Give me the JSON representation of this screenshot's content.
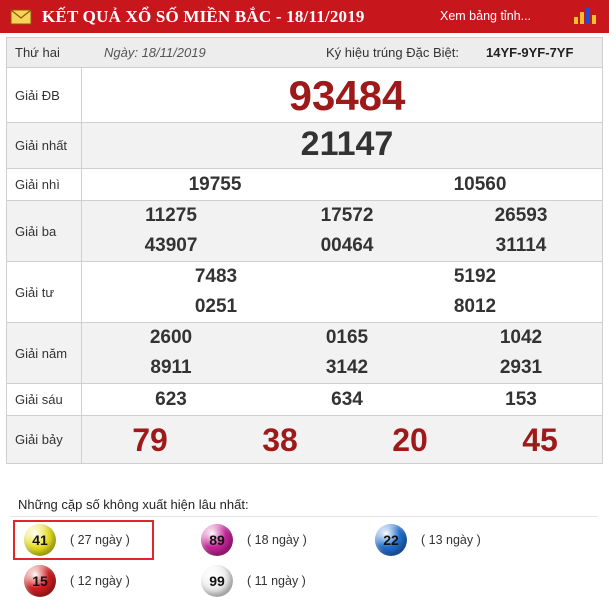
{
  "header": {
    "title": "KẾT QUẢ XỔ SỐ MIỀN BẮC - 18/11/2019",
    "link": "Xem bảng tỉnh...",
    "bg_color": "#c8161d",
    "mail_icon": "mail-icon",
    "chart_icon": "bar-chart-icon"
  },
  "info": {
    "day": "Thứ hai",
    "date": "Ngày: 18/11/2019",
    "special_code_label": "Ký hiệu trúng Đặc Biệt:",
    "special_code": "14YF-9YF-7YF"
  },
  "prizes": {
    "db": {
      "label": "Giải ĐB",
      "numbers": [
        "93484"
      ]
    },
    "nhat": {
      "label": "Giải nhất",
      "numbers": [
        "21147"
      ]
    },
    "nhi": {
      "label": "Giải nhì",
      "numbers": [
        "19755",
        "10560"
      ]
    },
    "ba": {
      "label": "Giải ba",
      "numbers": [
        "11275",
        "17572",
        "26593",
        "43907",
        "00464",
        "31114"
      ]
    },
    "tu": {
      "label": "Giải tư",
      "numbers": [
        "7483",
        "5192",
        "0251",
        "8012"
      ]
    },
    "nam": {
      "label": "Giải năm",
      "numbers": [
        "2600",
        "0165",
        "1042",
        "8911",
        "3142",
        "2931"
      ]
    },
    "sau": {
      "label": "Giải sáu",
      "numbers": [
        "623",
        "634",
        "153"
      ]
    },
    "bay": {
      "label": "Giải bảy",
      "numbers": [
        "79",
        "38",
        "20",
        "45"
      ]
    }
  },
  "missing_pairs": {
    "title": "Những cặp số không xuất hiện lâu nhất:",
    "items": [
      {
        "number": "41",
        "days": "( 27 ngày )",
        "color": "#e8e020"
      },
      {
        "number": "89",
        "days": "( 18 ngày )",
        "color": "#c8239a"
      },
      {
        "number": "22",
        "days": "( 13 ngày )",
        "color": "#1f6fd1"
      },
      {
        "number": "15",
        "days": "( 12 ngày )",
        "color": "#d11f1f"
      },
      {
        "number": "99",
        "days": "( 11 ngày )",
        "color": "#f0f0f0"
      }
    ],
    "highlight_color": "#e2252b"
  }
}
